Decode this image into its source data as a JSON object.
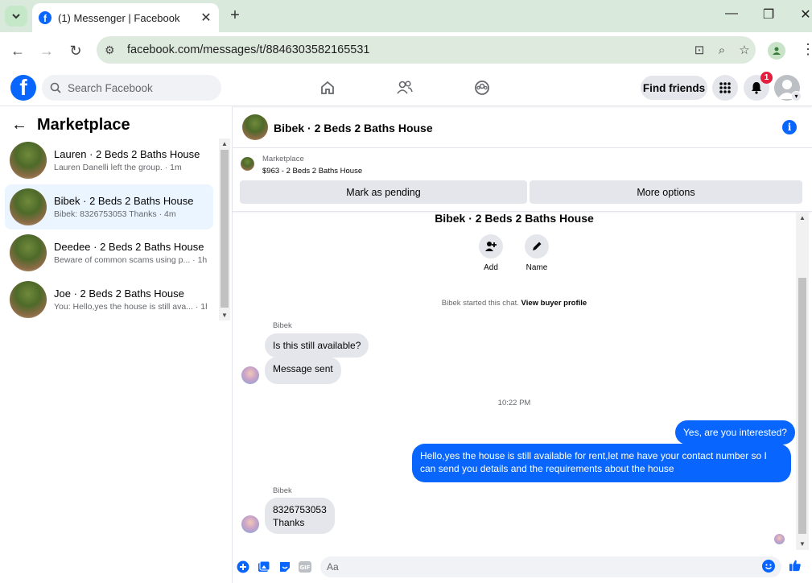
{
  "browser": {
    "tab_title": "(1) Messenger | Facebook",
    "url": "facebook.com/messages/t/8846303582165531"
  },
  "fb_header": {
    "search_placeholder": "Search Facebook",
    "find_friends_label": "Find friends",
    "notification_count": "1"
  },
  "left_panel": {
    "title": "Marketplace",
    "conversations": [
      {
        "name": "Lauren · 2 Beds 2 Baths House",
        "preview": "Lauren Danelli left the group. · 1m"
      },
      {
        "name": "Bibek · 2 Beds 2 Baths House",
        "preview": "Bibek: 8326753053 Thanks · 4m"
      },
      {
        "name": "Deedee · 2 Beds 2 Baths House",
        "preview": "Beware of common scams using p... · 1h"
      },
      {
        "name": "Joe · 2 Beds 2 Baths House",
        "preview": "You: Hello,yes the house is still ava... · 1h"
      }
    ]
  },
  "chat": {
    "header_name": "Bibek · 2 Beds 2 Baths House",
    "marketplace_label": "Marketplace",
    "listing": "$963 - 2 Beds 2 Baths House",
    "mark_pending_label": "Mark as pending",
    "more_options_label": "More options",
    "intro_name": "Bibek · 2 Beds 2 Baths House",
    "add_label": "Add",
    "name_label": "Name",
    "system_text": "Bibek started this chat.",
    "system_link": "View buyer profile",
    "sender_name": "Bibek",
    "messages_in_1": [
      "Is this still available?",
      "Message sent"
    ],
    "timestamp": "10:22 PM",
    "messages_out": [
      "Yes, are you interested?",
      "Hello,yes the house is still available for rent,let me have your contact number  so I can send you details and the requirements about the house"
    ],
    "message_in_2": [
      "8326753053",
      "Thanks"
    ],
    "composer_placeholder": "Aa"
  },
  "colors": {
    "brand": "#0866ff",
    "active_row": "#ebf5ff",
    "bubble_in": "#e4e6eb"
  }
}
